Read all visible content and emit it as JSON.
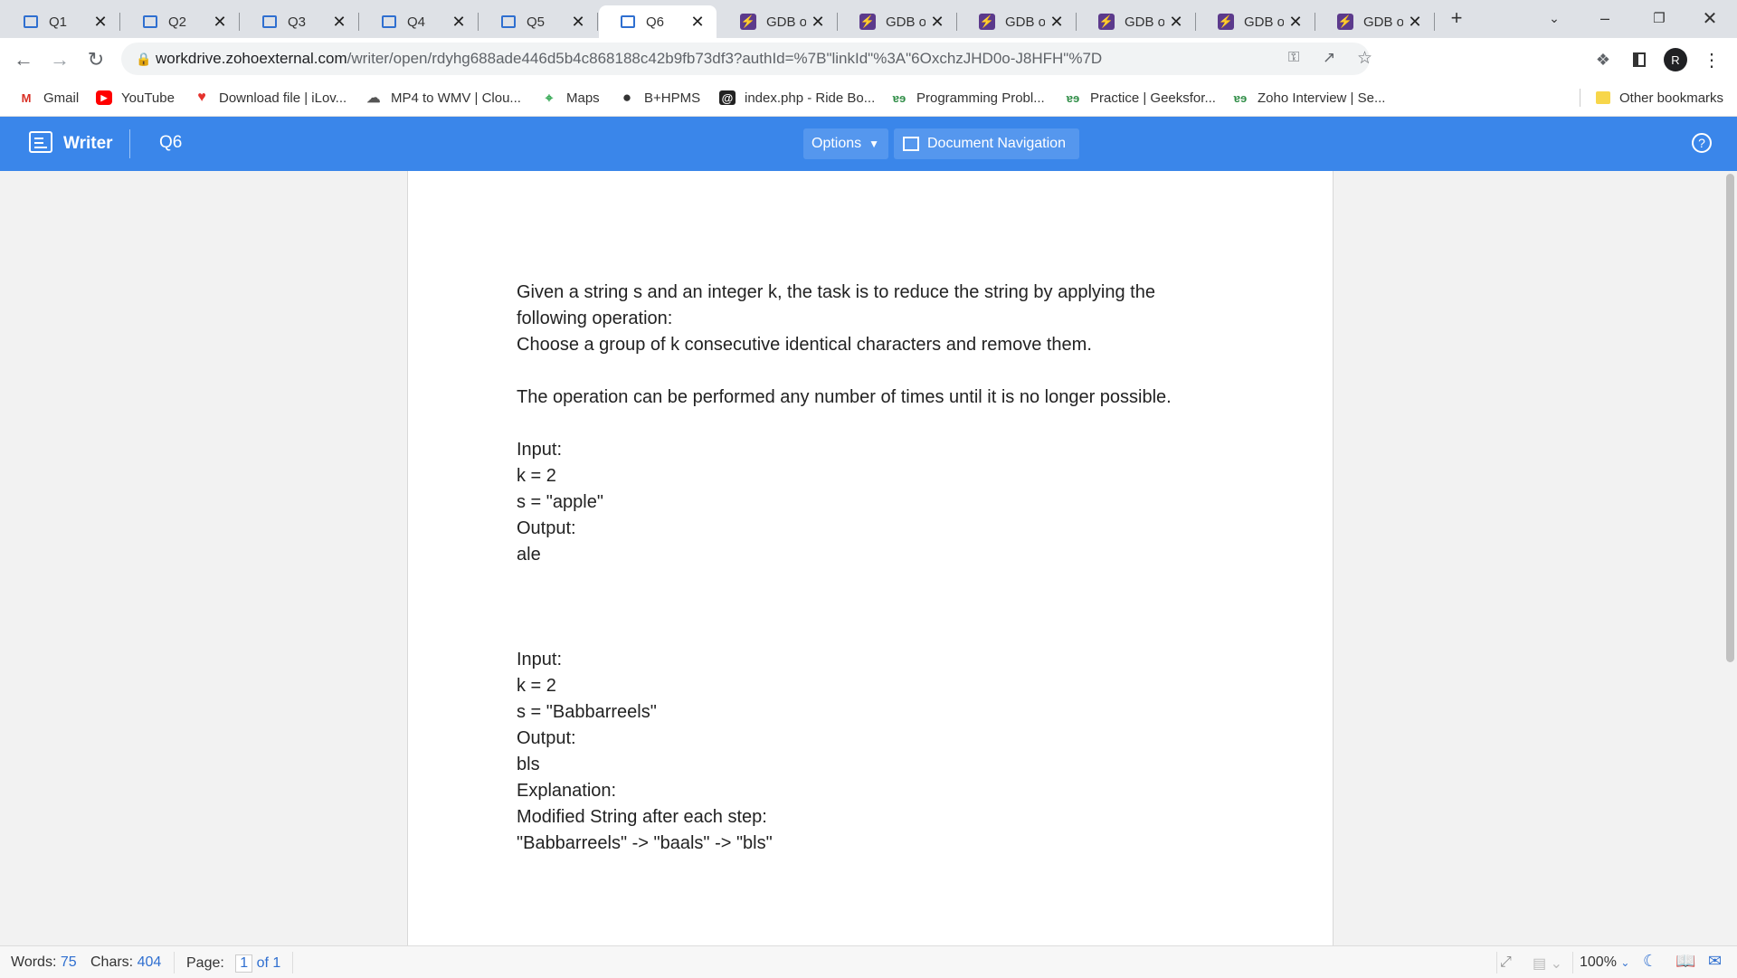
{
  "browser": {
    "tabs": [
      {
        "label": "Q1",
        "icon": "writer-doc-icon",
        "active": false
      },
      {
        "label": "Q2",
        "icon": "writer-doc-icon",
        "active": false
      },
      {
        "label": "Q3",
        "icon": "writer-doc-icon",
        "active": false
      },
      {
        "label": "Q4",
        "icon": "writer-doc-icon",
        "active": false
      },
      {
        "label": "Q5",
        "icon": "writer-doc-icon",
        "active": false
      },
      {
        "label": "Q6",
        "icon": "writer-doc-icon",
        "active": true
      },
      {
        "label": "GDB on",
        "icon": "gdb-icon",
        "active": false
      },
      {
        "label": "GDB on",
        "icon": "gdb-icon",
        "active": false
      },
      {
        "label": "GDB on",
        "icon": "gdb-icon",
        "active": false
      },
      {
        "label": "GDB on",
        "icon": "gdb-icon",
        "active": false
      },
      {
        "label": "GDB on",
        "icon": "gdb-icon",
        "active": false
      },
      {
        "label": "GDB on",
        "icon": "gdb-icon",
        "active": false
      }
    ],
    "url_host": "workdrive.zohoexternal.com",
    "url_path": "/writer/open/rdyhg688ade446d5b4c868188c42b9fb73df3?authId=%7B\"linkId\"%3A\"6OxchzJHD0o-J8HFH\"%7D",
    "profile_initial": "R",
    "bookmarks": [
      {
        "label": "Gmail",
        "icon": "gmail-icon"
      },
      {
        "label": "YouTube",
        "icon": "youtube-icon"
      },
      {
        "label": "Download file | iLov...",
        "icon": "ilovepdf-icon"
      },
      {
        "label": "MP4 to WMV | Clou...",
        "icon": "cloudconvert-icon"
      },
      {
        "label": "Maps",
        "icon": "maps-icon"
      },
      {
        "label": "B+HPMS",
        "icon": "globe-icon"
      },
      {
        "label": "index.php - Ride Bo...",
        "icon": "ridebooking-icon"
      },
      {
        "label": "Programming Probl...",
        "icon": "gfg-icon"
      },
      {
        "label": "Practice | Geeksfor...",
        "icon": "gfg-icon"
      },
      {
        "label": "Zoho Interview | Se...",
        "icon": "gfg-icon"
      }
    ],
    "other_bookmarks": "Other bookmarks"
  },
  "writer": {
    "app_name": "Writer",
    "doc_title": "Q6",
    "options_label": "Options",
    "nav_label": "Document Navigation"
  },
  "document": {
    "lines": [
      "Given a string s and an integer k, the task is to reduce the string by applying the",
      "following operation:",
      "Choose a group of k consecutive identical characters and remove them.",
      "",
      "The operation can be performed any number of times until it is no longer possible.",
      "",
      "Input:",
      "k = 2",
      "s = \"apple\"",
      "Output:",
      "ale",
      "",
      "",
      "",
      "Input:",
      "k = 2",
      "s = \"Babbarreels\"",
      "Output:",
      "bls",
      "Explanation:",
      "Modified String after each step:",
      "\"Babbarreels\" -> \"baals\" -> \"bls\""
    ]
  },
  "status": {
    "words_label": "Words:",
    "words": "75",
    "chars_label": "Chars:",
    "chars": "404",
    "page_label": "Page:",
    "page_current": "1",
    "page_total": "of 1",
    "zoom": "100%"
  },
  "colors": {
    "header_blue": "#3a86ea",
    "link_blue": "#2f6fd0"
  }
}
